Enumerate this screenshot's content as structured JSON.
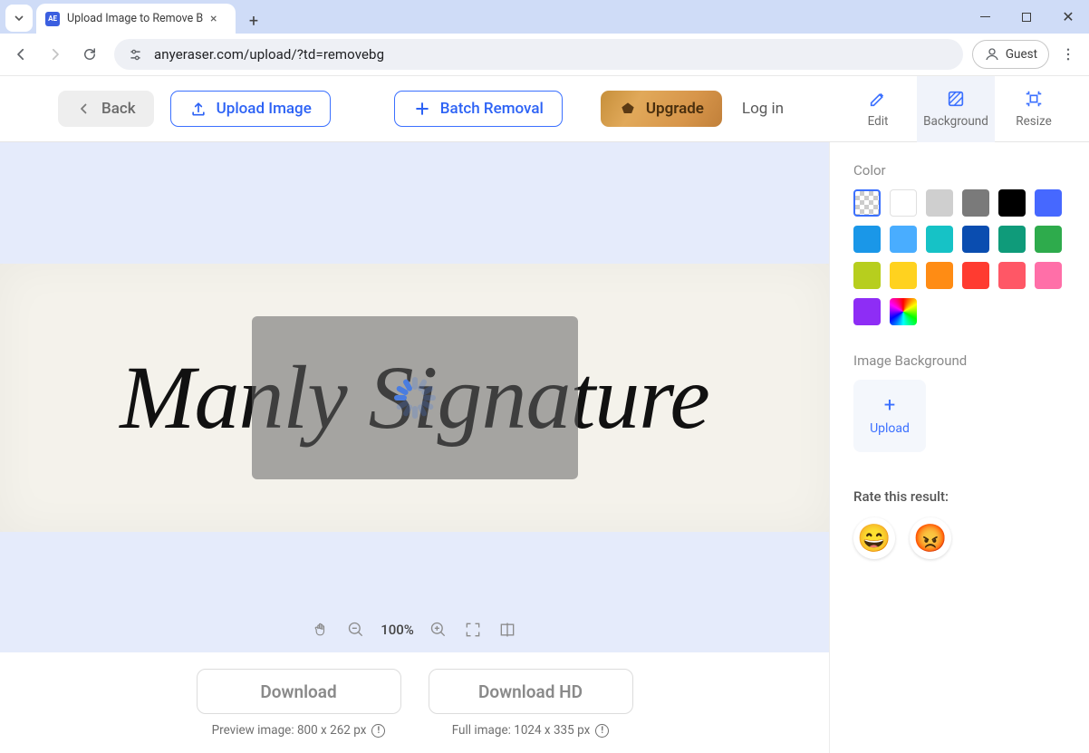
{
  "browser": {
    "tab_title": "Upload Image to Remove Bg",
    "url": "anyeraser.com/upload/?td=removebg",
    "guest_label": "Guest"
  },
  "toolbar": {
    "back_label": "Back",
    "upload_label": "Upload Image",
    "batch_label": "Batch Removal",
    "upgrade_label": "Upgrade",
    "login_label": "Log in",
    "tabs": {
      "edit": "Edit",
      "background": "Background",
      "resize": "Resize"
    }
  },
  "canvas": {
    "zoom": "100%",
    "signature_text": "Manly Signature"
  },
  "download": {
    "std_label": "Download",
    "std_sub": "Preview image: 800 x 262 px",
    "hd_label": "Download HD",
    "hd_sub": "Full image: 1024 x 335 px"
  },
  "panel": {
    "color_heading": "Color",
    "colors": [
      "transparent",
      "#ffffff",
      "#cfcfcf",
      "#7a7a7a",
      "#000000",
      "#4668ff",
      "#1a97e8",
      "#49adff",
      "#16c2c6",
      "#0a4db0",
      "#0f9b7a",
      "#2eab4c",
      "#b7ce1e",
      "#ffd21f",
      "#ff8c14",
      "#ff3b30",
      "#ff5766",
      "#ff6fa8",
      "#8e2df5",
      "rainbow"
    ],
    "image_bg_heading": "Image Background",
    "upload_label": "Upload",
    "rate_heading": "Rate this result:"
  }
}
